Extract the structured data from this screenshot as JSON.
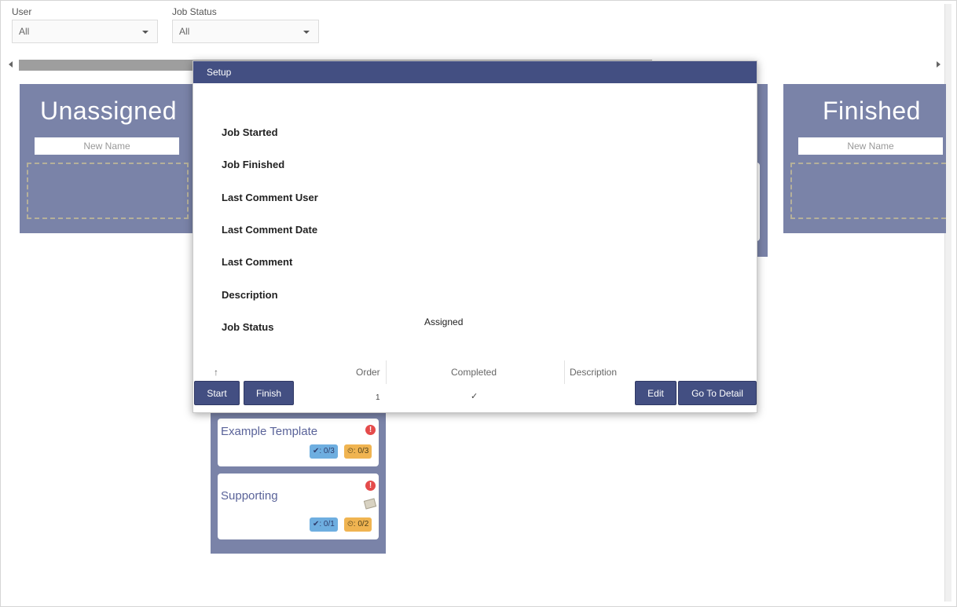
{
  "filters": {
    "user": {
      "label": "User",
      "value": "All"
    },
    "job_status": {
      "label": "Job Status",
      "value": "All"
    }
  },
  "columns": {
    "unassigned": {
      "title": "Unassigned",
      "new_name_placeholder": "New Name"
    },
    "finished": {
      "title": "Finished",
      "new_name_placeholder": "New Name"
    }
  },
  "cards": [
    {
      "title": "Example Template",
      "checks": "✔: 0/3",
      "timers": "⏲: 0/3"
    },
    {
      "title": "Supporting",
      "checks": "✔: 0/1",
      "timers": "⏲: 0/2"
    }
  ],
  "dialog": {
    "title": "Setup",
    "fields": {
      "job_started": "Job Started",
      "job_finished": "Job Finished",
      "last_comment_user": "Last Comment User",
      "last_comment_date": "Last Comment Date",
      "last_comment": "Last Comment",
      "description": "Description",
      "job_status": "Job Status",
      "job_status_value": "Assigned"
    },
    "grid": {
      "sort_arrow": "↑",
      "headers": {
        "order": "Order",
        "completed": "Completed",
        "description": "Description"
      },
      "row": {
        "order": "1",
        "completed": "✓"
      }
    },
    "buttons": {
      "start": "Start",
      "finish": "Finish",
      "edit": "Edit",
      "go_to_detail": "Go To Detail"
    }
  },
  "colors": {
    "column_bg": "#7a83a8",
    "header_bg": "#434f82",
    "badge_blue": "#6eaee0",
    "badge_orange": "#f0b451",
    "alert_red": "#e44b4b"
  }
}
